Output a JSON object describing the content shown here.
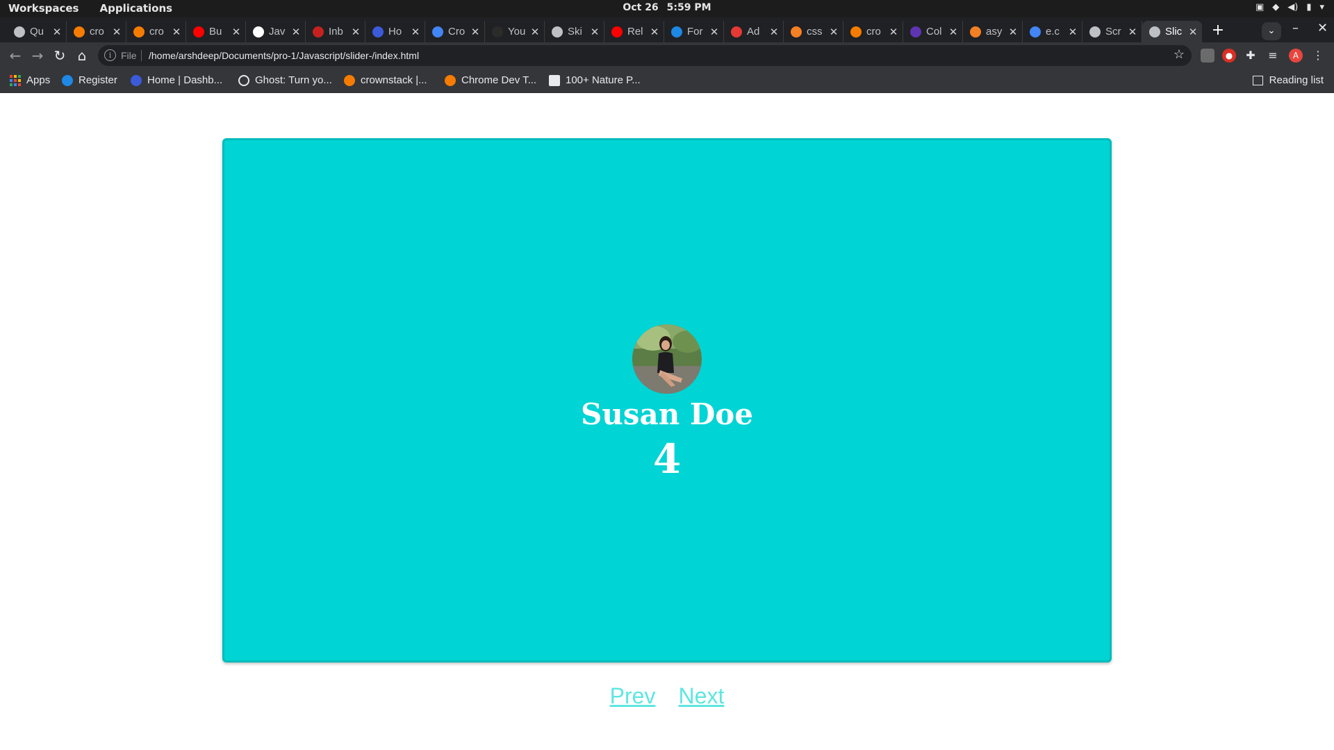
{
  "os": {
    "workspaces": "Workspaces",
    "applications": "Applications",
    "date": "Oct 26",
    "time": "5:59 PM"
  },
  "tabs": [
    {
      "label": "Qu",
      "icon": "globe-icon",
      "color": "#bdc1c6"
    },
    {
      "label": "cro",
      "icon": "crownstack-icon",
      "color": "#f57c00"
    },
    {
      "label": "cro",
      "icon": "crownstack-icon",
      "color": "#f57c00"
    },
    {
      "label": "Bu",
      "icon": "youtube-icon",
      "color": "#ff0000"
    },
    {
      "label": "Jav",
      "icon": "pocket-icon",
      "color": "#ffffff"
    },
    {
      "label": "Inb",
      "icon": "gmail-icon",
      "color": "#c5221f"
    },
    {
      "label": "Ho",
      "icon": "k-icon",
      "color": "#3b5bdb"
    },
    {
      "label": "Cro",
      "icon": "calendar-icon",
      "color": "#4285f4"
    },
    {
      "label": "You",
      "icon": "github-icon",
      "color": "#2b2b2b"
    },
    {
      "label": "Ski",
      "icon": "globe-icon",
      "color": "#bdc1c6"
    },
    {
      "label": "Rel",
      "icon": "youtube-icon",
      "color": "#ff0000"
    },
    {
      "label": "For",
      "icon": "k-icon",
      "color": "#1e88e5"
    },
    {
      "label": "Ad",
      "icon": "asterisk-icon",
      "color": "#e53935"
    },
    {
      "label": "css",
      "icon": "stackoverflow-icon",
      "color": "#f48024"
    },
    {
      "label": "cro",
      "icon": "crownstack-icon",
      "color": "#f57c00"
    },
    {
      "label": "Col",
      "icon": "c-icon",
      "color": "#5e35b1"
    },
    {
      "label": "asy",
      "icon": "stackoverflow-icon",
      "color": "#f48024"
    },
    {
      "label": "e.c",
      "icon": "google-icon",
      "color": "#4285f4"
    },
    {
      "label": "Scr",
      "icon": "globe-icon",
      "color": "#bdc1c6"
    },
    {
      "label": "Slic",
      "icon": "globe-icon",
      "color": "#bdc1c6",
      "active": true
    }
  ],
  "toolbar": {
    "scheme": "File",
    "url": "/home/arshdeep/Documents/pro-1/Javascript/slider-/index.html"
  },
  "bookmarks": {
    "apps": "Apps",
    "items": [
      {
        "label": "Register",
        "icon": "k-icon",
        "color": "#1e88e5"
      },
      {
        "label": "Home | Dashb...",
        "icon": "k-icon",
        "color": "#3b5bdb"
      },
      {
        "label": "Ghost: Turn yo...",
        "icon": "ghost-icon",
        "color": "#35363a"
      },
      {
        "label": "crownstack |...",
        "icon": "crownstack-icon",
        "color": "#f57c00"
      },
      {
        "label": "Chrome Dev T...",
        "icon": "crownstack-icon",
        "color": "#f57c00"
      },
      {
        "label": "100+ Nature P...",
        "icon": "unsplash-icon",
        "color": "#ffffff"
      }
    ],
    "reading_list": "Reading list"
  },
  "slide": {
    "name": "Susan Doe",
    "number": "4",
    "background": "#00d4d4"
  },
  "controls": {
    "prev": "Prev",
    "next": "Next"
  }
}
